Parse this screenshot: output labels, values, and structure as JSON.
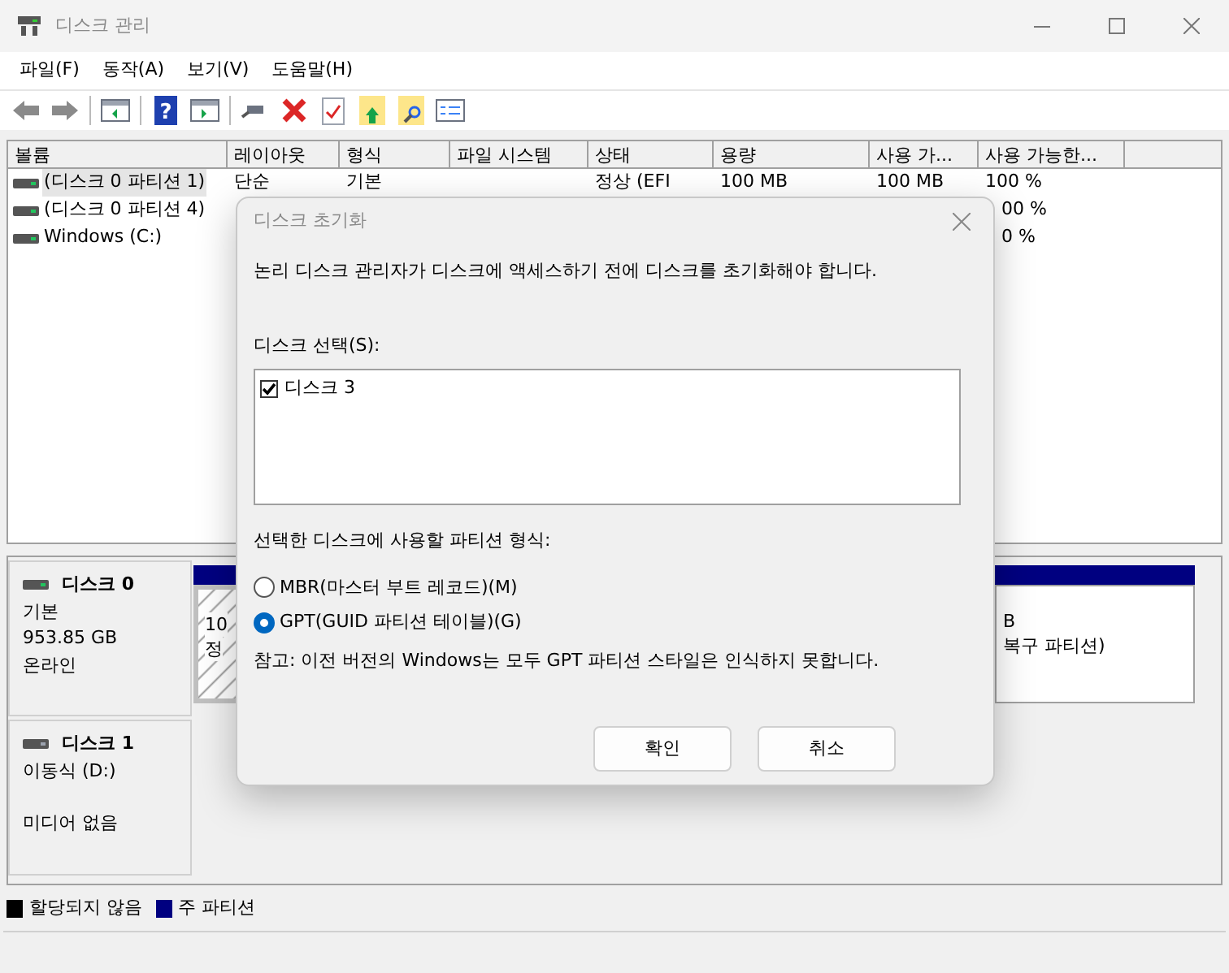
{
  "window": {
    "title": "디스크 관리"
  },
  "toolbar": {
    "help_glyph": "?"
  },
  "menu": [
    "파일(F)",
    "동작(A)",
    "보기(V)",
    "도움말(H)"
  ],
  "volume_table": {
    "columns": [
      "볼륨",
      "레이아웃",
      "형식",
      "파일 시스템",
      "상태",
      "용량",
      "사용 가...",
      "사용 가능한..."
    ],
    "rows": [
      {
        "selected": true,
        "cells": [
          "(디스크 0 파티션 1)",
          "단순",
          "기본",
          "",
          "정상 (EFI",
          "100 MB",
          "100 MB",
          "100 %"
        ]
      },
      {
        "selected": false,
        "cells": [
          "(디스크 0 파티션 4)",
          "",
          "",
          "",
          "",
          "",
          "",
          "00 %"
        ]
      },
      {
        "selected": false,
        "cells": [
          "Windows (C:)",
          "",
          "",
          "",
          "",
          "",
          "",
          "0 %"
        ]
      }
    ]
  },
  "disks": [
    {
      "name": "디스크 0",
      "kind": "basic",
      "type": "기본",
      "size": "953.85 GB",
      "status": "온라인",
      "partitions": [
        {
          "kind": "hatched",
          "lines": [
            "10",
            "정"
          ]
        },
        {
          "kind": "plain",
          "lines": [
            "B",
            "복구 파티션)"
          ]
        }
      ]
    },
    {
      "name": "디스크 1",
      "kind": "removable",
      "type": "이동식 (D:)",
      "status": "미디어 없음"
    }
  ],
  "legend": [
    {
      "label": "할당되지 않음",
      "color": "#000000"
    },
    {
      "label": "주 파티션",
      "color": "#000080"
    }
  ],
  "dialog": {
    "title": "디스크 초기화",
    "message": "논리 디스크 관리자가 디스크에 액세스하기 전에 디스크를 초기화해야 합니다.",
    "disk_list_label": "디스크 선택(S):",
    "disks": [
      {
        "label": "디스크 3",
        "checked": true
      }
    ],
    "style_label": "선택한 디스크에 사용할 파티션 형식:",
    "styles": [
      {
        "label": "MBR(마스터 부트 레코드)(M)",
        "selected": false
      },
      {
        "label": "GPT(GUID 파티션 테이블)(G)",
        "selected": true
      }
    ],
    "note": "참고: 이전 버전의 Windows는 모두 GPT 파티션 스타일은 인식하지 못합니다.",
    "buttons": [
      "확인",
      "취소"
    ]
  }
}
